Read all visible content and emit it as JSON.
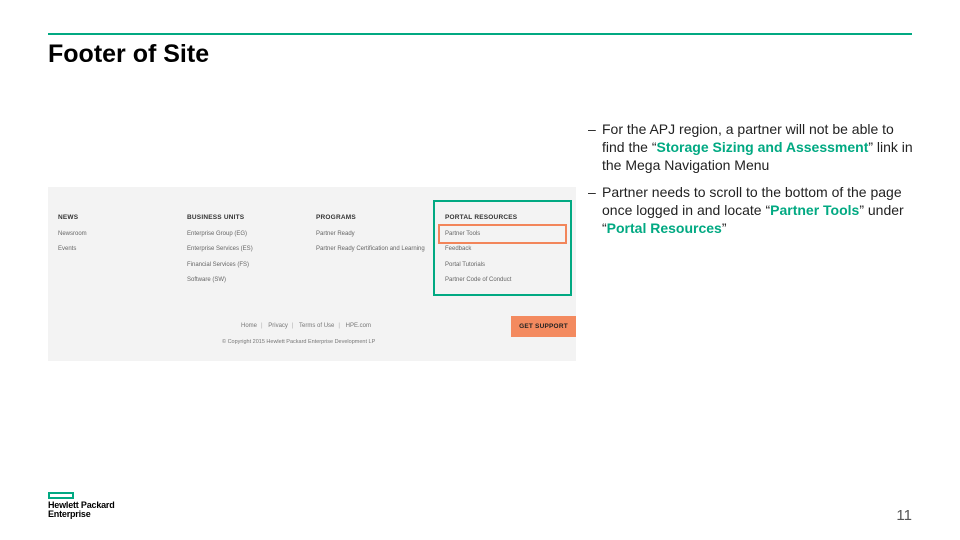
{
  "slide": {
    "title": "Footer of Site",
    "page_number": "11"
  },
  "accent_color": "#01a982",
  "highlight_orange": "#f2855a",
  "footer_screenshot": {
    "columns": [
      {
        "heading": "NEWS",
        "links": [
          "Newsroom",
          "Events"
        ]
      },
      {
        "heading": "BUSINESS UNITS",
        "links": [
          "Enterprise Group (EG)",
          "Enterprise Services (ES)",
          "Financial Services (FS)",
          "Software (SW)"
        ]
      },
      {
        "heading": "PROGRAMS",
        "links": [
          "Partner Ready",
          "Partner Ready Certification and Learning"
        ]
      },
      {
        "heading": "PORTAL RESOURCES",
        "links": [
          "Partner Tools",
          "Feedback",
          "Portal Tutorials",
          "Partner Code of Conduct"
        ]
      }
    ],
    "legal_links": [
      "Home",
      "Privacy",
      "Terms of Use",
      "HPE.com"
    ],
    "copyright": "© Copyright 2015 Hewlett Packard Enterprise Development LP",
    "support_button": "GET SUPPORT"
  },
  "bullets": {
    "b1_a": "For the APJ region, a partner will not be able to find the “",
    "b1_hl": "Storage Sizing and Assessment",
    "b1_b": "” link in the Mega Navigation Menu",
    "b2_a": "Partner needs to scroll to the bottom of the page once logged in and locate “",
    "b2_hl1": "Partner Tools",
    "b2_b": "” under “",
    "b2_hl2": "Portal Resources",
    "b2_c": "”"
  },
  "logo": {
    "line1": "Hewlett Packard",
    "line2": "Enterprise"
  }
}
